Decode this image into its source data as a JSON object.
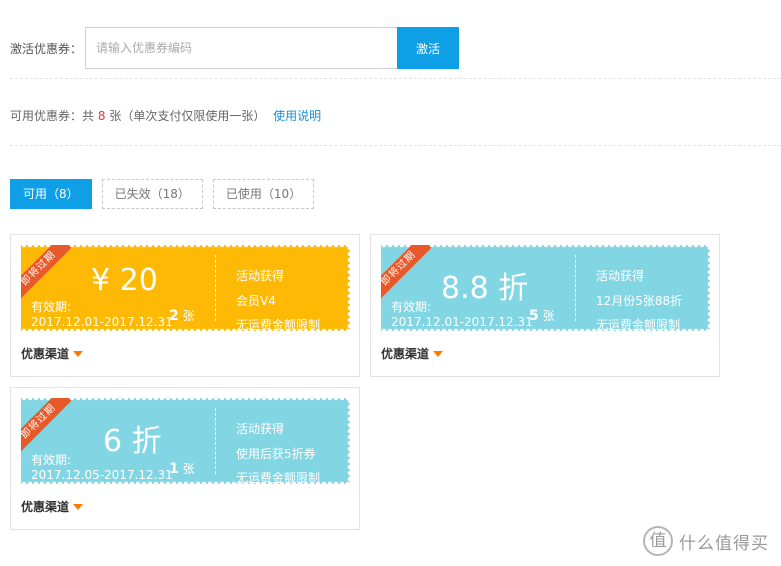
{
  "activate": {
    "label": "激活优惠券：",
    "placeholder": "请输入优惠券编码",
    "button": "激活"
  },
  "summary": {
    "prefix": "可用优惠券：共",
    "count": "8",
    "suffix": "张（单次支付仅限使用一张）",
    "help_link": "使用说明"
  },
  "tabs": [
    {
      "label": "可用（8）"
    },
    {
      "label": "已失效（18）"
    },
    {
      "label": "已使用（10）"
    }
  ],
  "coupons": [
    {
      "color": "#fdb903",
      "ribbon": "即将过期",
      "amount": "¥ 20",
      "validity_label": "有效期:",
      "validity_range": "2017.12.01-2017.12.31",
      "qty": "2",
      "qty_unit": "张",
      "info": [
        "活动获得",
        "会员V4",
        "无运费金额限制"
      ],
      "channel": "优惠渠道"
    },
    {
      "color": "#82d6e4",
      "ribbon": "即将过期",
      "amount": "8.8 折",
      "validity_label": "有效期:",
      "validity_range": "2017.12.01-2017.12.31",
      "qty": "5",
      "qty_unit": "张",
      "info": [
        "活动获得",
        "12月份5张88折",
        "无运费金额限制"
      ],
      "channel": "优惠渠道"
    },
    {
      "color": "#82d6e4",
      "ribbon": "即将过期",
      "amount": "6 折",
      "validity_label": "有效期:",
      "validity_range": "2017.12.05-2017.12.31",
      "qty": "1",
      "qty_unit": "张",
      "info": [
        "活动获得",
        "使用后获5折券",
        "无运费金额限制"
      ],
      "channel": "优惠渠道"
    }
  ],
  "watermark": {
    "logo": "值",
    "text": "什么值得买"
  },
  "colors": {
    "accent": "#0e9fe6",
    "coupon_yellow": "#fdb903",
    "coupon_cyan": "#82d6e4",
    "ribbon": "#e8592a",
    "count": "#e53935"
  }
}
